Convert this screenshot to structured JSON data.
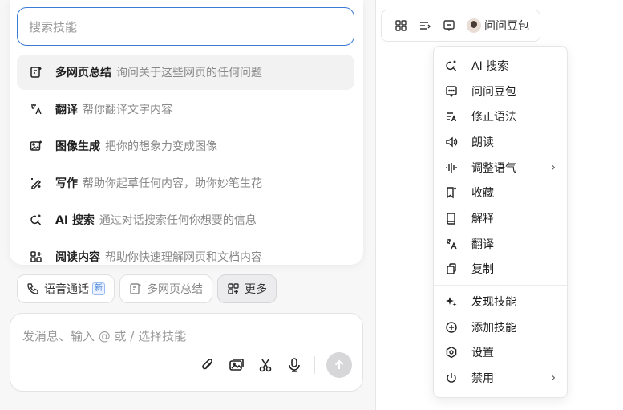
{
  "skill_panel": {
    "search_placeholder": "搜索技能",
    "skills": [
      {
        "icon": "webpage-summary-icon",
        "name": "多网页总结",
        "desc": "询问关于这些网页的任何问题"
      },
      {
        "icon": "translate-icon",
        "name": "翻译",
        "desc": "帮你翻译文字内容"
      },
      {
        "icon": "image-generate-icon",
        "name": "图像生成",
        "desc": "把你的想象力变成图像"
      },
      {
        "icon": "writing-icon",
        "name": "写作",
        "desc": "帮助你起草任何内容，助你妙笔生花"
      },
      {
        "icon": "ai-search-icon",
        "name": "AI 搜索",
        "desc": "通过对话搜索任何你想要的信息"
      },
      {
        "icon": "reading-icon",
        "name": "阅读内容",
        "desc": "帮助你快速理解网页和文档内容"
      }
    ]
  },
  "chips": {
    "voice_call": "语音通话",
    "new_badge": "新",
    "multi_page_summary": "多网页总结",
    "more": "更多"
  },
  "composer": {
    "placeholder": "发消息、输入 @ 或 / 选择技能"
  },
  "toolbar": {
    "ask_doubao": "问问豆包"
  },
  "menu": {
    "items_top": [
      {
        "icon": "ai-search-icon",
        "label": "AI 搜索"
      },
      {
        "icon": "chat-icon",
        "label": "问问豆包"
      },
      {
        "icon": "grammar-icon",
        "label": "修正语法"
      },
      {
        "icon": "speaker-icon",
        "label": "朗读"
      },
      {
        "icon": "waveform-icon",
        "label": "调整语气",
        "submenu": true
      },
      {
        "icon": "bookmark-icon",
        "label": "收藏"
      },
      {
        "icon": "book-icon",
        "label": "解释"
      },
      {
        "icon": "translate-icon",
        "label": "翻译"
      },
      {
        "icon": "copy-icon",
        "label": "复制"
      }
    ],
    "items_bottom": [
      {
        "icon": "sparkle-icon",
        "label": "发现技能"
      },
      {
        "icon": "add-circle-icon",
        "label": "添加技能"
      },
      {
        "icon": "gear-icon",
        "label": "设置"
      },
      {
        "icon": "power-icon",
        "label": "禁用",
        "submenu": true
      }
    ]
  },
  "colors": {
    "accent": "#3a7bd5",
    "muted_text": "#888888"
  }
}
